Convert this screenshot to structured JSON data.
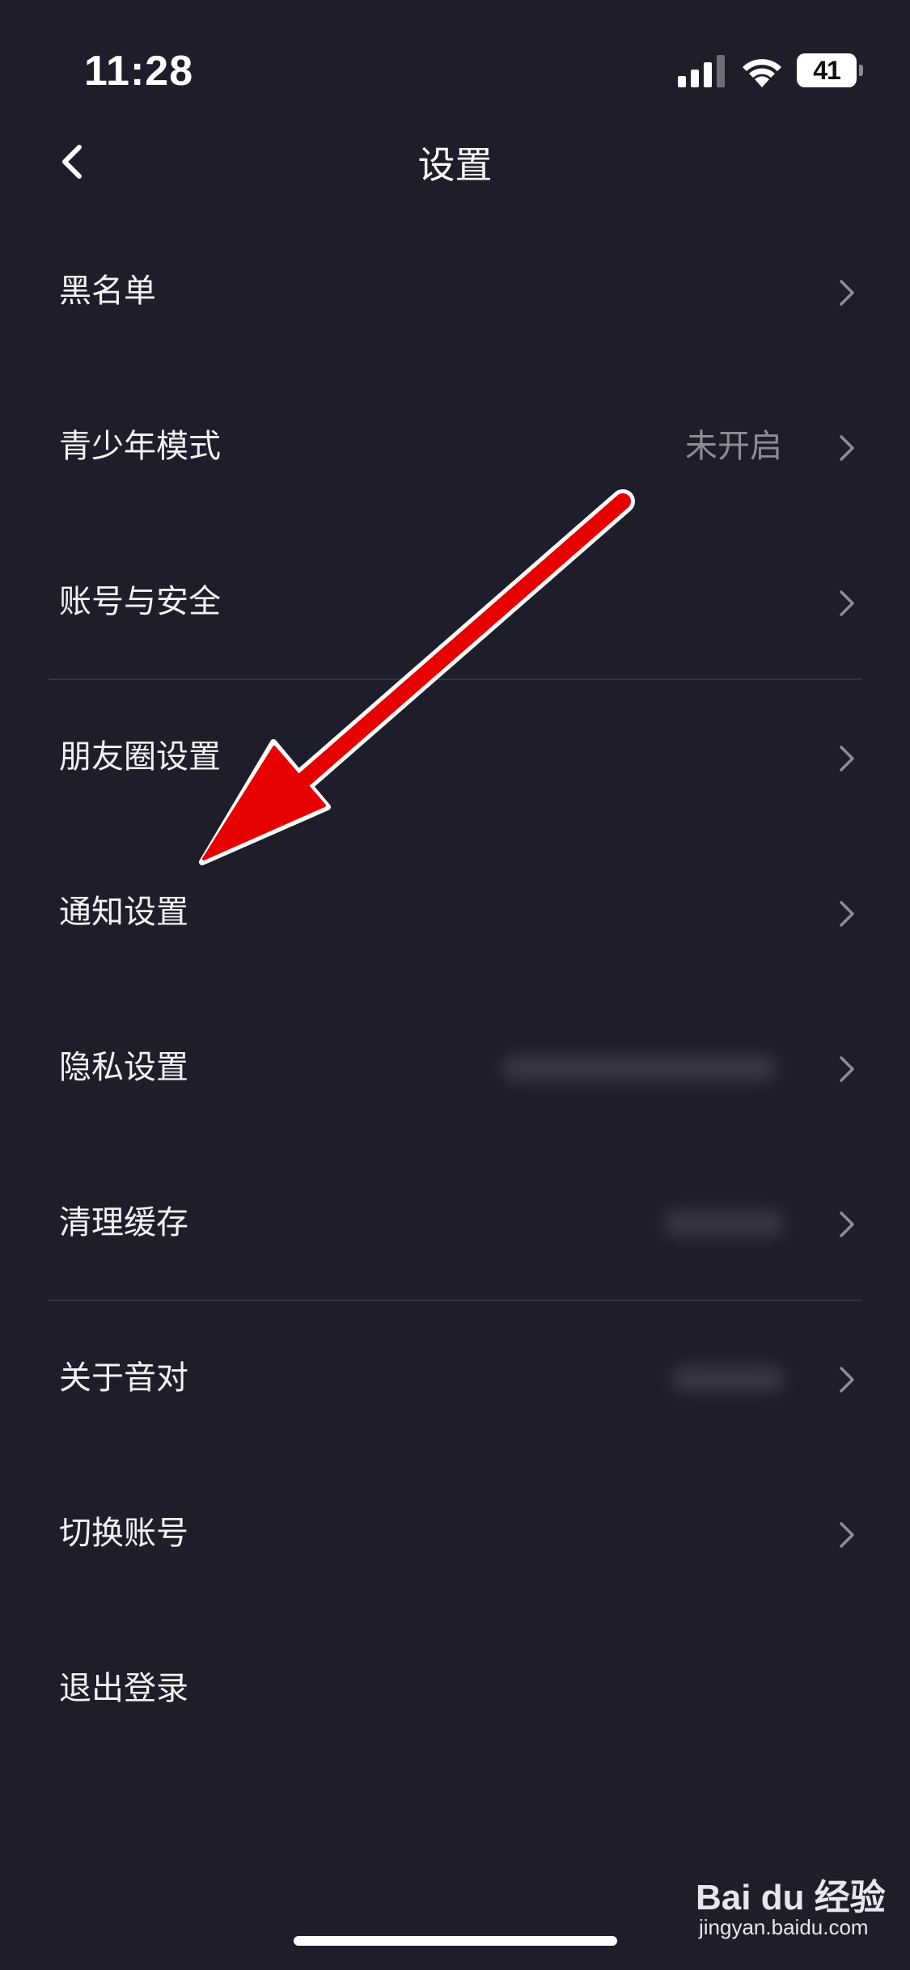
{
  "status_bar": {
    "time": "11:28",
    "battery_level": "41",
    "icons": [
      "signal-icon",
      "wifi-icon",
      "battery-icon"
    ]
  },
  "nav": {
    "title": "设置",
    "back_icon": "chevron-left-icon"
  },
  "settings": {
    "items": [
      {
        "label": "黑名单",
        "value": ""
      },
      {
        "label": "青少年模式",
        "value": "未开启"
      },
      {
        "label": "账号与安全",
        "value": ""
      },
      {
        "label": "朋友圈设置",
        "value": ""
      },
      {
        "label": "通知设置",
        "value": ""
      },
      {
        "label": "隐私设置",
        "value": ""
      },
      {
        "label": "清理缓存",
        "value": ""
      },
      {
        "label": "关于音对",
        "value": ""
      },
      {
        "label": "切换账号",
        "value": ""
      },
      {
        "label": "退出登录",
        "value": ""
      }
    ]
  },
  "annotation": {
    "color": "#e60000",
    "outline": "#ffffff"
  },
  "watermark": {
    "logo": "Bai du 经验",
    "url": "jingyan.baidu.com"
  },
  "colors": {
    "background": "#1e1e2b",
    "text_primary": "#f2f2f5",
    "text_secondary": "#8d8d98",
    "divider": "#34343f"
  }
}
